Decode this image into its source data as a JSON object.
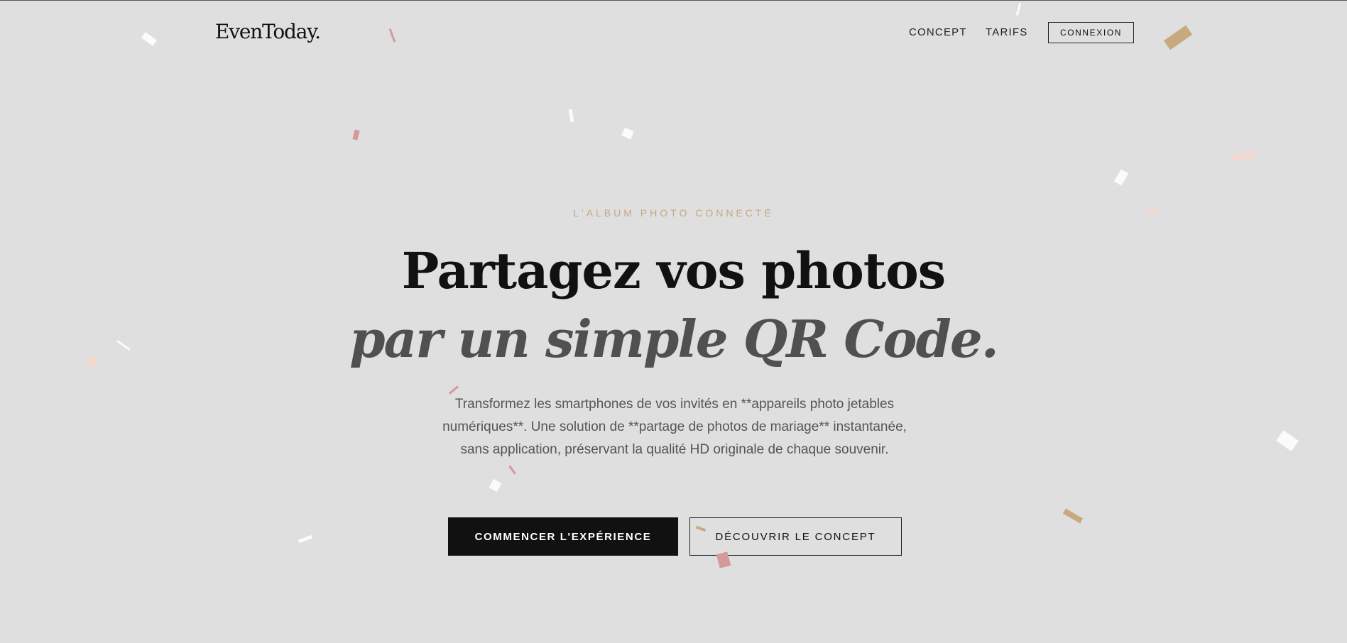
{
  "header": {
    "logo": "EvenToday.",
    "nav": {
      "concept": "CONCEPT",
      "tarifs": "TARIFS",
      "connexion": "CONNEXION"
    }
  },
  "hero": {
    "eyebrow": "L'ALBUM PHOTO CONNECTÉ",
    "headline_line1": "Partagez vos photos",
    "headline_line2": "par un simple QR Code.",
    "subtitle": "Transformez les smartphones de vos invités en **appareils photo jetables numériques**. Une solution de **partage de photos de mariage** instantanée, sans application, préservant la qualité HD originale de chaque souvenir.",
    "cta_primary": "COMMENCER L'EXPÉRIENCE",
    "cta_secondary": "DÉCOUVRIR LE CONCEPT"
  },
  "colors": {
    "background": "#dfdfdf",
    "accent_gold": "#c7a882",
    "text_dark": "#111111",
    "headline_italic": "#505050",
    "confetti": [
      "#fbfbfb",
      "#c9aa80",
      "#d49a9a",
      "#f6d8cc"
    ]
  }
}
